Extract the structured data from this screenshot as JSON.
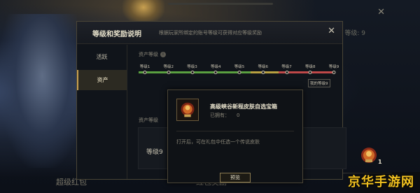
{
  "background": {
    "bottom_left_label": "超级红包",
    "bottom_mid_label": "红包奖励",
    "top_right_level": "等级: 9",
    "watermark": "京华手游网"
  },
  "modal": {
    "title": "等级和奖励说明",
    "subtitle": "根据玩家所绑定的账号等级可获得对应等级奖励",
    "close_glyph": "✕"
  },
  "sidebar": {
    "items": [
      {
        "label": "活跃",
        "active": false
      },
      {
        "label": "资产",
        "active": true
      }
    ]
  },
  "asset_level": {
    "section_label": "资产等级",
    "info_glyph": "i",
    "ticks": [
      "等级1",
      "等级2",
      "等级3",
      "等级4",
      "等级5",
      "等级6",
      "等级7",
      "等级8",
      "等级9"
    ],
    "my_level_badge": "我的等级9"
  },
  "asset_reward": {
    "section_label": "资产等级",
    "level_text": "等级9",
    "reward_count": "1"
  },
  "popup": {
    "title": "高级峡谷新程皮肤自选宝箱",
    "owned_label": "已拥有：",
    "owned_value": "0",
    "description": "打开后，可在礼包中任选一个传说皮肤",
    "preview_button": "预览"
  },
  "colors": {
    "accent_gold": "#c8a050",
    "track_green": "#5aa040",
    "track_red": "#c04848",
    "watermark": "#f0c020"
  }
}
